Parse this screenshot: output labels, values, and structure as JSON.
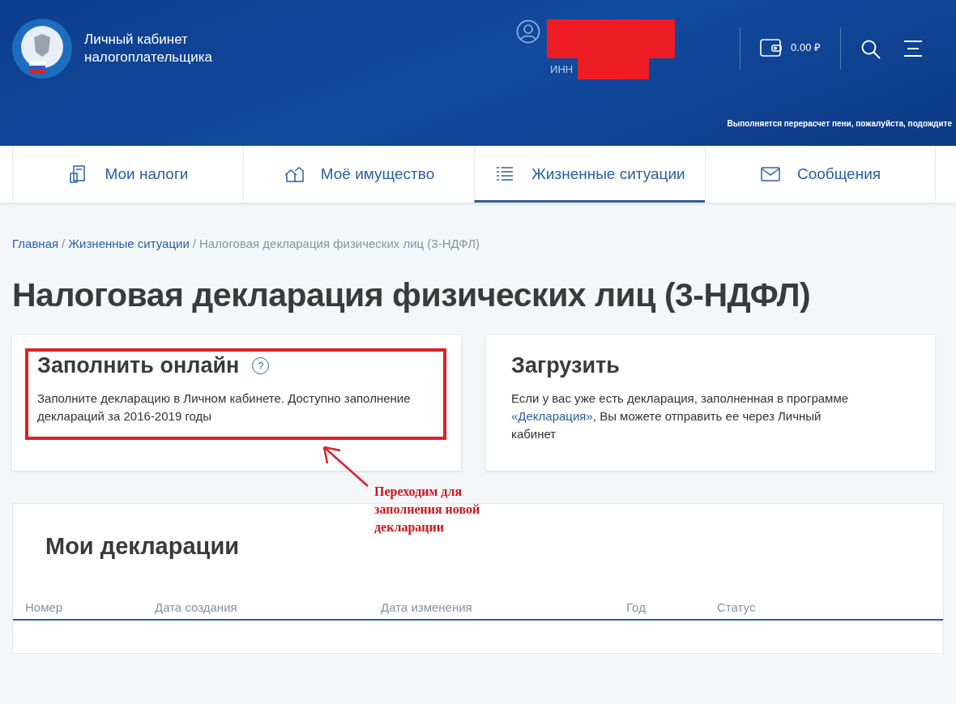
{
  "header": {
    "title_line1": "Личный кабинет",
    "title_line2": "налогоплательщика",
    "inn_label": "ИНН",
    "balance": "0.00 ₽",
    "notice": "Выполняется перерасчет пени, пожалуйста, подождите"
  },
  "tabs": [
    {
      "label": "Мои налоги",
      "selected": false
    },
    {
      "label": "Моё имущество",
      "selected": false
    },
    {
      "label": "Жизненные ситуации",
      "selected": true
    },
    {
      "label": "Сообщения",
      "selected": false
    }
  ],
  "breadcrumb_separator": "/",
  "breadcrumb": [
    {
      "label": "Главная",
      "link": true
    },
    {
      "label": "Жизненные ситуации",
      "link": true
    },
    {
      "label": "Налоговая декларация физических лиц (3-НДФЛ)",
      "link": false
    }
  ],
  "help_label": "?",
  "page_title": "Налоговая декларация физических лиц (3-НДФЛ)",
  "cards": [
    {
      "title": "Заполнить онлайн",
      "help": true,
      "highlighted": true,
      "text": "Заполните декларацию в Личном кабинете. Доступно заполнение деклараций за 2016-2019 годы"
    },
    {
      "title": "Загрузить",
      "help": false,
      "highlighted": false,
      "text_before": "Если у вас уже есть декларация, заполненная в программе ",
      "link": "«Декларация»",
      "text_after": ", Вы можете отправить ее через Личный кабинет"
    }
  ],
  "annotation": "Переходим для заполнения новой декларации",
  "declarations": {
    "title": "Мои декларации",
    "columns": [
      "Номер",
      "Дата создания",
      "Дата изменения",
      "Год",
      "Статус"
    ]
  }
}
